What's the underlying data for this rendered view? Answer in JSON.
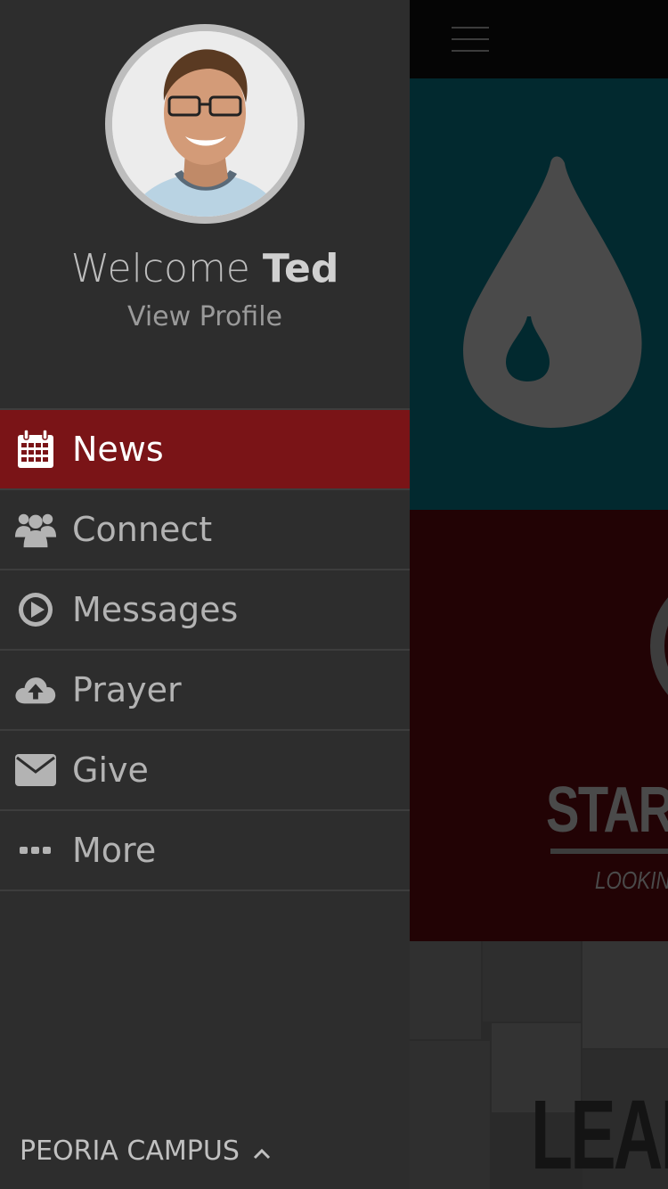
{
  "drawer": {
    "welcome_prefix": "Welcome",
    "user_name": "Ted",
    "view_profile": "View Profile",
    "menu": [
      {
        "label": "News",
        "icon": "calendar-icon",
        "active": true
      },
      {
        "label": "Connect",
        "icon": "users-icon",
        "active": false
      },
      {
        "label": "Messages",
        "icon": "play-circle-icon",
        "active": false
      },
      {
        "label": "Prayer",
        "icon": "cloud-upload-icon",
        "active": false
      },
      {
        "label": "Give",
        "icon": "envelope-icon",
        "active": false
      },
      {
        "label": "More",
        "icon": "ellipsis-icon",
        "active": false
      }
    ],
    "campus": "PEORIA CAMPUS"
  },
  "content": {
    "card2_title": "STAR",
    "card2_subtitle": "LOOKING",
    "card3_title": "LEAI"
  },
  "colors": {
    "drawer_bg": "#2d2d2d",
    "active_item": "#7a1417",
    "teal_card": "#02292f",
    "red_card": "#220305"
  }
}
